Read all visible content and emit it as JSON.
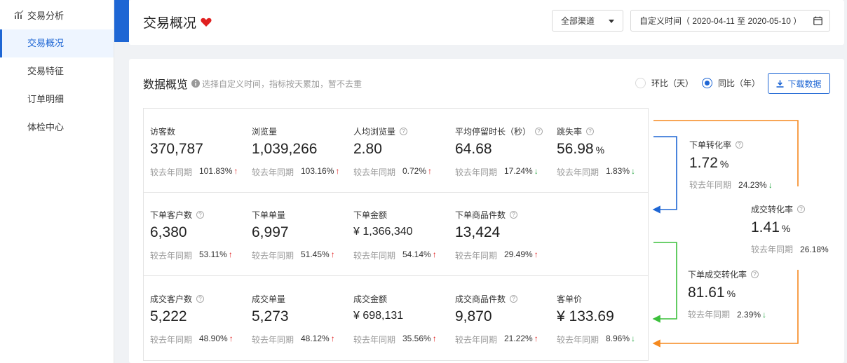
{
  "sidebar": {
    "header": "交易分析",
    "items": [
      {
        "label": "交易概况",
        "active": true
      },
      {
        "label": "交易特征",
        "active": false
      },
      {
        "label": "订单明细",
        "active": false
      },
      {
        "label": "体检中心",
        "active": false
      }
    ]
  },
  "header": {
    "title": "交易概况",
    "channel": "全部渠道",
    "date_range": "自定义时间（ 2020-04-11 至 2020-05-10 ）"
  },
  "overview": {
    "title": "数据概览",
    "hint": "选择自定义时间，指标按天累加，暂不去重",
    "radio_day": "环比（天）",
    "radio_year": "同比（年）",
    "selected": "year",
    "download": "下载数据",
    "compare_label": "较去年同期"
  },
  "colors": {
    "accent": "#1e66d4",
    "up": "#e02020",
    "down": "#28a745",
    "orange": "#f5891f",
    "green": "#3cc03c"
  },
  "metrics": [
    [
      {
        "label": "访客数",
        "value": "370,787",
        "unit": "",
        "help": false,
        "pct": "101.83%",
        "trend": "up"
      },
      {
        "label": "浏览量",
        "value": "1,039,266",
        "unit": "",
        "help": false,
        "pct": "103.16%",
        "trend": "up"
      },
      {
        "label": "人均浏览量",
        "value": "2.80",
        "unit": "",
        "help": true,
        "pct": "0.72%",
        "trend": "up"
      },
      {
        "label": "平均停留时长（秒）",
        "value": "64.68",
        "unit": "",
        "help": true,
        "pct": "17.24%",
        "trend": "down"
      },
      {
        "label": "跳失率",
        "value": "56.98",
        "unit": "%",
        "help": true,
        "pct": "1.83%",
        "trend": "down"
      }
    ],
    [
      {
        "label": "下单客户数",
        "value": "6,380",
        "unit": "",
        "help": true,
        "pct": "53.11%",
        "trend": "up"
      },
      {
        "label": "下单单量",
        "value": "6,997",
        "unit": "",
        "help": false,
        "pct": "51.45%",
        "trend": "up"
      },
      {
        "label": "下单金额",
        "value": "¥ 1,366,340",
        "unit": "",
        "help": false,
        "pct": "54.14%",
        "trend": "up",
        "small": true
      },
      {
        "label": "下单商品件数",
        "value": "13,424",
        "unit": "",
        "help": true,
        "pct": "29.49%",
        "trend": "up"
      }
    ],
    [
      {
        "label": "成交客户数",
        "value": "5,222",
        "unit": "",
        "help": true,
        "pct": "48.90%",
        "trend": "up"
      },
      {
        "label": "成交单量",
        "value": "5,273",
        "unit": "",
        "help": false,
        "pct": "48.12%",
        "trend": "up"
      },
      {
        "label": "成交金额",
        "value": "¥ 698,131",
        "unit": "",
        "help": false,
        "pct": "35.56%",
        "trend": "up",
        "small": true
      },
      {
        "label": "成交商品件数",
        "value": "9,870",
        "unit": "",
        "help": true,
        "pct": "21.22%",
        "trend": "up"
      },
      {
        "label": "客单价",
        "value": "¥ 133.69",
        "unit": "",
        "help": false,
        "pct": "8.96%",
        "trend": "down"
      }
    ]
  ],
  "funnel": [
    {
      "key": "order_conv",
      "label": "下单转化率",
      "value": "1.72",
      "unit": "%",
      "pct": "24.23%",
      "trend": "down"
    },
    {
      "key": "deal_conv",
      "label": "成交转化率",
      "value": "1.41",
      "unit": "%",
      "pct": "26.18%",
      "trend": "none"
    },
    {
      "key": "order_deal_conv",
      "label": "下单成交转化率",
      "value": "81.61",
      "unit": "%",
      "pct": "2.39%",
      "trend": "down"
    }
  ]
}
